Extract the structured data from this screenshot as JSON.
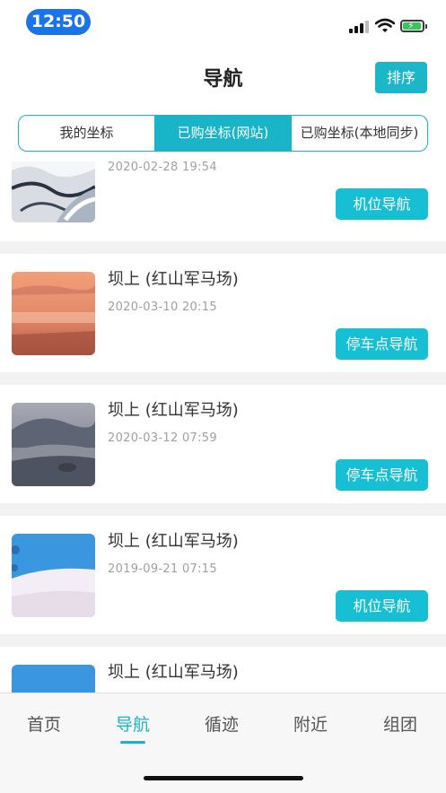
{
  "status_bar": {
    "time": "12:50"
  },
  "header": {
    "title": "导航",
    "sort_label": "排序"
  },
  "tabs": [
    {
      "label": "我的坐标",
      "active": false
    },
    {
      "label": "已购坐标(网站)",
      "active": true
    },
    {
      "label": "已购坐标(本地同步)",
      "active": false
    }
  ],
  "items": [
    {
      "title": "",
      "date": "2020-02-28 19:54",
      "button": "机位导航",
      "thumb_icon": "snow-river-photo"
    },
    {
      "title": "坝上 (红山军马场)",
      "date": "2020-03-10 20:15",
      "button": "停车点导航",
      "thumb_icon": "sunrise-fog-photo"
    },
    {
      "title": "坝上 (红山军马场)",
      "date": "2020-03-12 07:59",
      "button": "停车点导航",
      "thumb_icon": "hills-fog-photo"
    },
    {
      "title": "坝上 (红山军马场)",
      "date": "2019-09-21 07:15",
      "button": "机位导航",
      "thumb_icon": "blue-snow-photo"
    },
    {
      "title": "坝上 (红山军马场)",
      "date": "",
      "button": "",
      "thumb_icon": "blue-snow-photo"
    }
  ],
  "tabbar": [
    {
      "label": "首页",
      "active": false
    },
    {
      "label": "导航",
      "active": true
    },
    {
      "label": "循迹",
      "active": false
    },
    {
      "label": "附近",
      "active": false
    },
    {
      "label": "组团",
      "active": false
    }
  ],
  "colors": {
    "accent": "#19b4c8",
    "button": "#17bfd4",
    "time_pill": "#1a73e8"
  }
}
